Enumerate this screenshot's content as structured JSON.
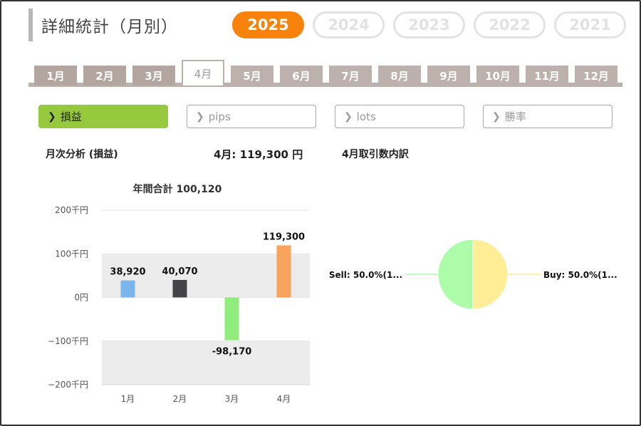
{
  "title": "詳細統計（月別）",
  "years": [
    "2025",
    "2024",
    "2023",
    "2022",
    "2021"
  ],
  "active_year": "2025",
  "months": [
    "1月",
    "2月",
    "3月",
    "4月",
    "5月",
    "6月",
    "7月",
    "8月",
    "9月",
    "10月",
    "11月",
    "12月"
  ],
  "active_month": "4月",
  "metrics": [
    "損益",
    "pips",
    "lots",
    "勝率"
  ],
  "active_metric": "損益",
  "summary": {
    "section_label": "月次分析 (損益)",
    "month_total": "4月:  119,300 円",
    "breakdown_label": "4月取引数内訳"
  },
  "colors": {
    "accent": "#f7830c",
    "active_metric": "#96c93d",
    "tab": "#bcb1ac"
  },
  "chart_data": [
    {
      "type": "bar",
      "title": "年間合計 100,120",
      "categories": [
        "1月",
        "2月",
        "3月",
        "4月"
      ],
      "values": [
        38920,
        40070,
        -98170,
        119300
      ],
      "value_labels": [
        "38,920",
        "40,070",
        "-98,170",
        "119,300"
      ],
      "bar_colors": [
        "#7cb5ec",
        "#434348",
        "#90ed7d",
        "#f7a35c"
      ],
      "yticks": [
        200000,
        100000,
        0,
        -100000,
        -200000
      ],
      "ytick_labels": [
        "200千円",
        "100千円",
        "0円",
        "−100千円",
        "−200千円"
      ],
      "ylim": [
        -200000,
        200000
      ],
      "grid": true
    },
    {
      "type": "pie",
      "slices": [
        {
          "label": "Sell: 50.0%(1...",
          "value": 50.0,
          "color": "#adfcaa"
        },
        {
          "label": "Buy: 50.0%(1...",
          "value": 50.0,
          "color": "#ffee96"
        }
      ]
    }
  ]
}
